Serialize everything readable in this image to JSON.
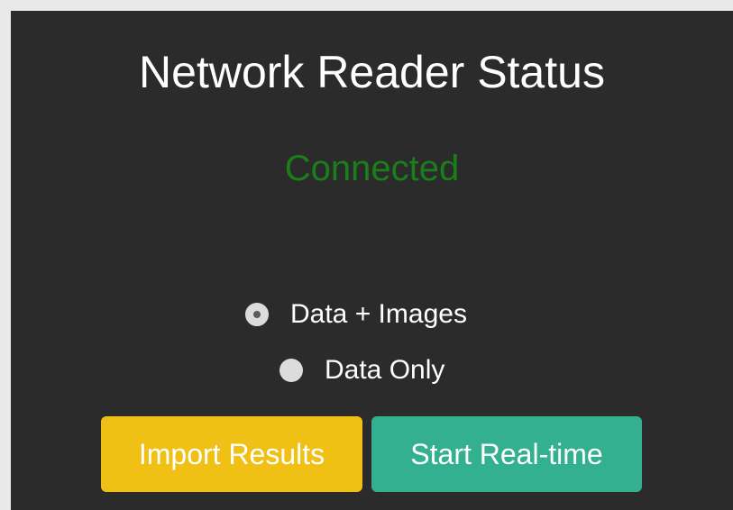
{
  "title": "Network Reader Status",
  "status": {
    "text": "Connected",
    "color": "#1a7f1a"
  },
  "mode": {
    "options": [
      {
        "label": "Data + Images",
        "selected": true
      },
      {
        "label": "Data Only",
        "selected": false
      }
    ]
  },
  "buttons": {
    "import_label": "Import Results",
    "import_color": "#f0c014",
    "realtime_label": "Start Real-time",
    "realtime_color": "#32b08f"
  }
}
